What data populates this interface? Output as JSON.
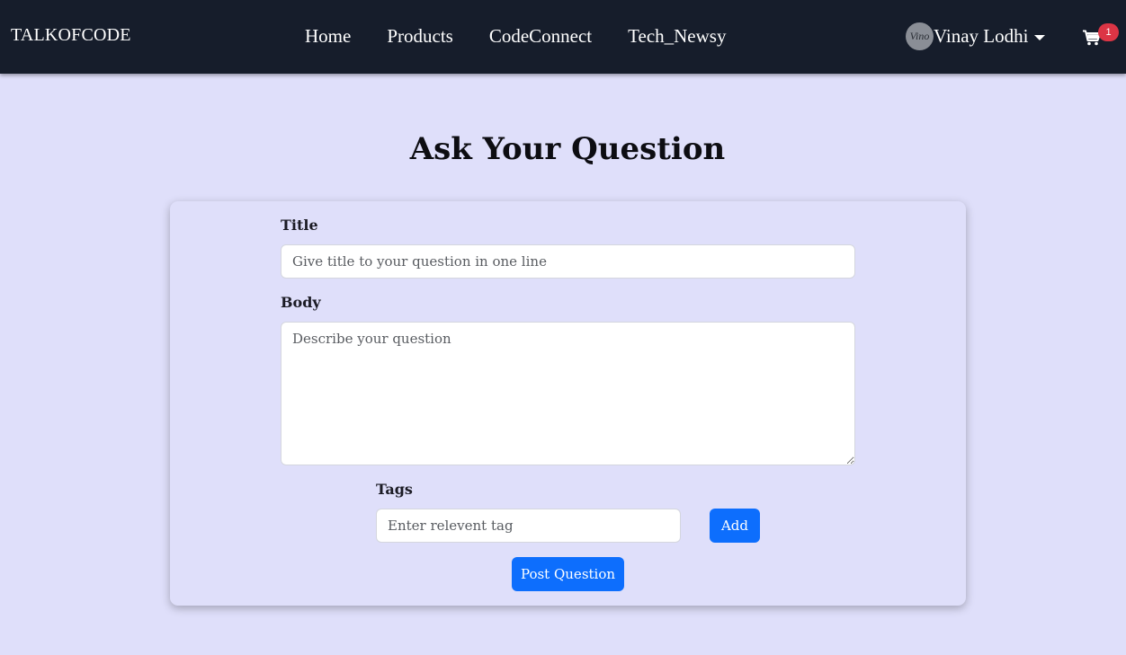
{
  "navbar": {
    "brand": "TALKOFCODE",
    "links": [
      "Home",
      "Products",
      "CodeConnect",
      "Tech_Newsy"
    ],
    "user": {
      "avatar_text": "Vino",
      "name": "Vinay Lodhi"
    },
    "cart": {
      "icon": "shopping-cart-icon",
      "count": "1"
    }
  },
  "page": {
    "title": "Ask Your Question"
  },
  "form": {
    "title_label": "Title",
    "title_placeholder": "Give title to your question in one line",
    "body_label": "Body",
    "body_placeholder": "Describe your question",
    "tags_label": "Tags",
    "tags_placeholder": "Enter relevent tag",
    "add_label": "Add",
    "submit_label": "Post Question"
  },
  "colors": {
    "navbar_bg": "#161d2b",
    "page_bg": "#dfdffa",
    "primary": "#0d6efd",
    "badge": "#dc3545"
  }
}
